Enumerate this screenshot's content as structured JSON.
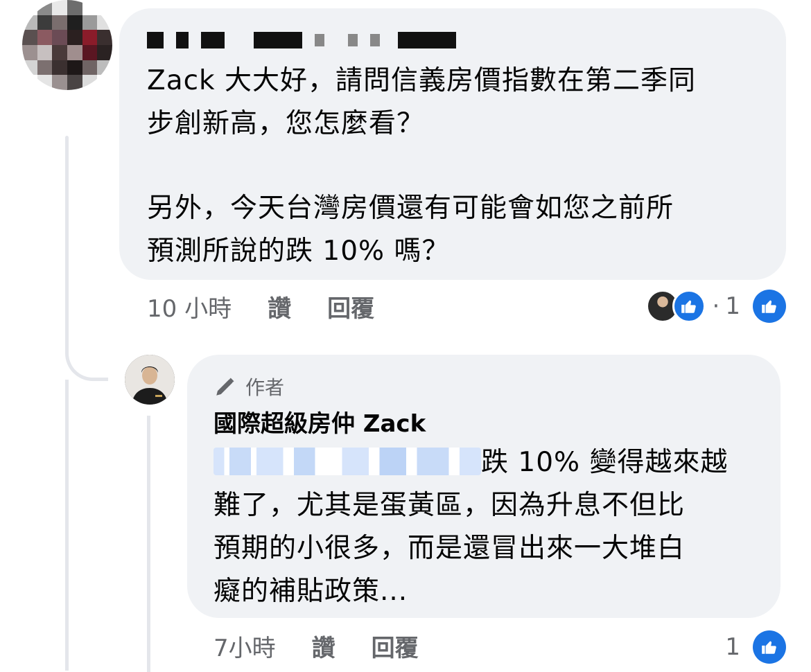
{
  "comment1": {
    "text_p1": "Zack 大大好，請問信義房價指數在第二季同\n步創新高，您怎麼看？",
    "text_p2": "另外，今天台灣房價還有可能會如您之前所\n預測所說的跌 10% 嗎？",
    "time": "10 小時",
    "like_label": "讚",
    "reply_label": "回覆",
    "reaction_sep": "·",
    "reaction_count": "1",
    "icons": [
      "blurred-avatar",
      "mini-avatar",
      "like-icon"
    ]
  },
  "reply": {
    "badge_label": "作者",
    "author_name": "國際超級房仲 Zack",
    "text": "跌 10% 變得越來越\n難了，尤其是蛋黃區，因為升息不但比\n預期的小很多，而是還冒出來一大堆白\n癡的補貼政策...",
    "time": "7小時",
    "like_label": "讚",
    "reply_label": "回覆",
    "reaction_count": "1",
    "icons": [
      "pen-icon",
      "avatar",
      "like-icon"
    ]
  },
  "colors": {
    "bubble_bg": "#f0f2f5",
    "meta_text": "#65676b",
    "like_blue": "#1b74e4",
    "thread_line": "#e4e6eb"
  }
}
